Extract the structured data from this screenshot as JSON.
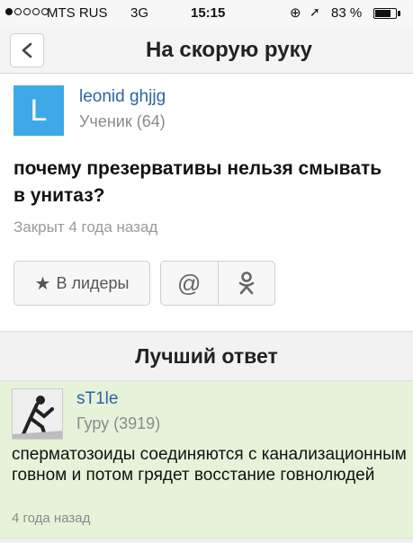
{
  "status_bar": {
    "carrier": "MTS RUS",
    "network": "3G",
    "time": "15:15",
    "battery_percent": "83 %",
    "battery_level": 0.83,
    "signal_bars_filled": 1,
    "signal_bars_total": 5
  },
  "nav": {
    "back_icon": "chevron-left-icon",
    "title": "На скорую руку"
  },
  "question": {
    "author_initial": "L",
    "author_name": "leonid ghjjg",
    "author_rank": "Ученик (64)",
    "text": "почему презервативы нельзя смывать в унитаз?",
    "status": "Закрыт 4 года назад"
  },
  "actions": {
    "leaders_icon": "star-icon",
    "leaders_label": "В лидеры",
    "mail_glyph": "@",
    "ok_icon": "odnoklassniki-icon"
  },
  "best_answer": {
    "header": "Лучший ответ",
    "author_name": "sT1le",
    "author_rank": "Гуру (3919)",
    "text": "сперматозоиды соединяются с канализационным говном и потом грядет восстание говнолюдей",
    "time": "4 года назад"
  },
  "colors": {
    "link": "#2a64a8",
    "avatar_bg": "#3ea9e8",
    "answer_bg": "#e6f3d9"
  }
}
